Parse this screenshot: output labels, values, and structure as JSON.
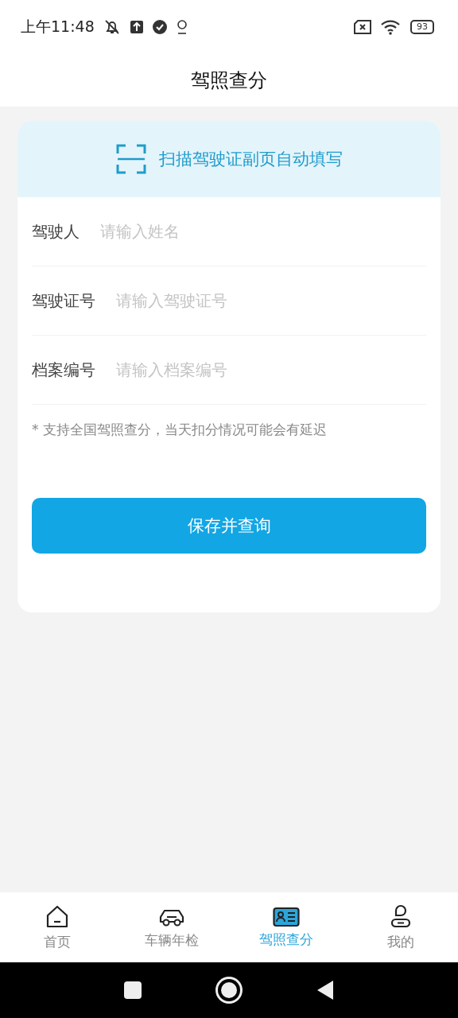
{
  "status_bar": {
    "time": "上午11:48",
    "battery": "93"
  },
  "header": {
    "title": "驾照查分"
  },
  "scan_banner": {
    "label": "扫描驾驶证副页自动填写"
  },
  "fields": [
    {
      "label": "驾驶人",
      "placeholder": "请输入姓名"
    },
    {
      "label": "驾驶证号",
      "placeholder": "请输入驾驶证号"
    },
    {
      "label": "档案编号",
      "placeholder": "请输入档案编号"
    }
  ],
  "note": "* 支持全国驾照查分，当天扣分情况可能会有延迟",
  "submit_button": "保存并查询",
  "tabs": [
    {
      "kind": "home",
      "label": "首页",
      "selected": false
    },
    {
      "kind": "car",
      "label": "车辆年检",
      "selected": false
    },
    {
      "kind": "license",
      "label": "驾照查分",
      "selected": true
    },
    {
      "kind": "user",
      "label": "我的",
      "selected": false
    }
  ]
}
